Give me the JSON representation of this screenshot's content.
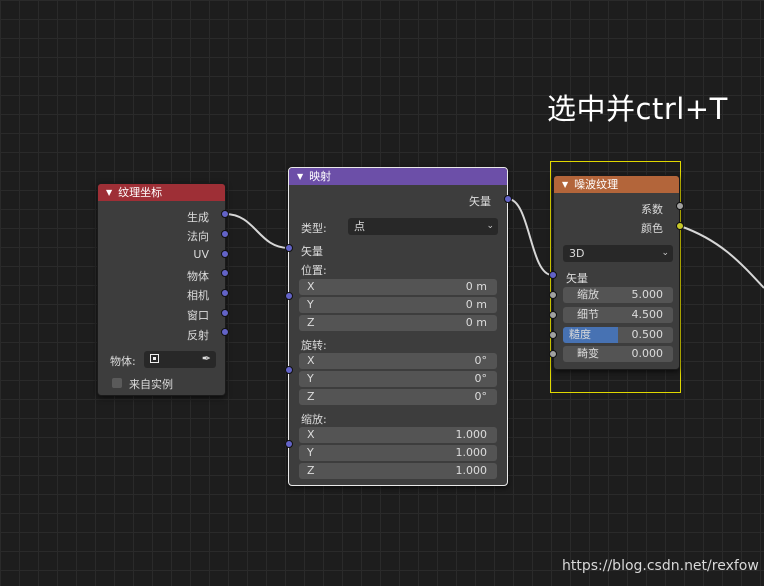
{
  "overlay_title": "选中并ctrl+T",
  "watermark": "https://blog.csdn.net/rexfow",
  "colors": {
    "texcoord_header": "#9e2f36",
    "mapping_header": "#6c4fa8",
    "noise_header": "#b3653a",
    "vector_socket": "#6363c7",
    "float_socket": "#a1a1a1",
    "color_socket": "#c7c729",
    "slider_fill": "#4772b3",
    "selection": "#e0d800"
  },
  "texcoord": {
    "title": "纹理坐标",
    "outputs": [
      "生成",
      "法向",
      "UV",
      "物体",
      "相机",
      "窗口",
      "反射"
    ],
    "object_label": "物体:",
    "from_instancer_label": "来自实例"
  },
  "mapping": {
    "title": "映射",
    "output_vector": "矢量",
    "type_label": "类型:",
    "type_value": "点",
    "input_vector": "矢量",
    "location_label": "位置:",
    "location": [
      {
        "axis": "X",
        "value": "0 m"
      },
      {
        "axis": "Y",
        "value": "0 m"
      },
      {
        "axis": "Z",
        "value": "0 m"
      }
    ],
    "rotation_label": "旋转:",
    "rotation": [
      {
        "axis": "X",
        "value": "0°"
      },
      {
        "axis": "Y",
        "value": "0°"
      },
      {
        "axis": "Z",
        "value": "0°"
      }
    ],
    "scale_label": "缩放:",
    "scale": [
      {
        "axis": "X",
        "value": "1.000"
      },
      {
        "axis": "Y",
        "value": "1.000"
      },
      {
        "axis": "Z",
        "value": "1.000"
      }
    ]
  },
  "noise": {
    "title": "噪波纹理",
    "output_fac": "系数",
    "output_color": "颜色",
    "dimension": "3D",
    "input_vector": "矢量",
    "params": [
      {
        "label": "缩放",
        "value": "5.000"
      },
      {
        "label": "细节",
        "value": "4.500"
      },
      {
        "label": "糙度",
        "value": "0.500",
        "fill": 0.5
      },
      {
        "label": "畸变",
        "value": "0.000"
      }
    ]
  }
}
